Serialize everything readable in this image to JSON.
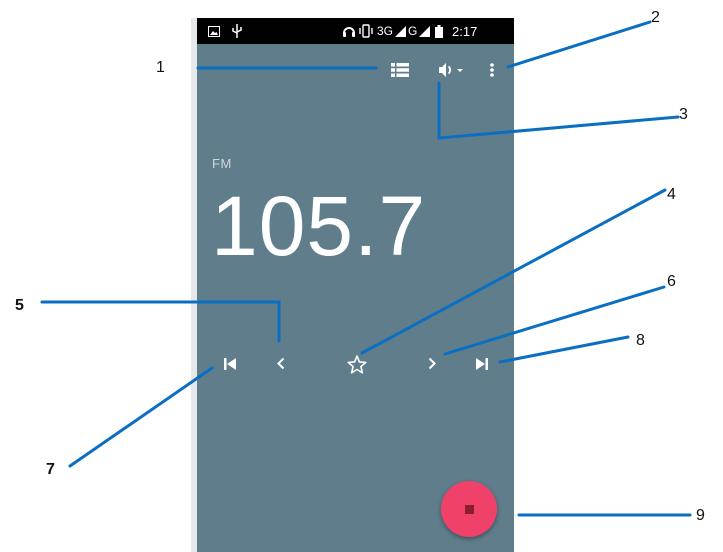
{
  "status_bar": {
    "network": "3G",
    "network_2": "G",
    "time": "2:17",
    "icons": [
      "image-icon",
      "usb-icon",
      "headset-icon",
      "vibrate-icon",
      "signal-icon",
      "signal-icon",
      "battery-icon"
    ]
  },
  "toolbar": {
    "icons": [
      "station-list-icon",
      "speaker-icon",
      "overflow-menu-icon"
    ]
  },
  "radio": {
    "band": "FM",
    "frequency": "105.7"
  },
  "controls": {
    "icons": [
      "skip-previous-icon",
      "chevron-left-icon",
      "star-outline-icon",
      "chevron-right-icon",
      "skip-next-icon"
    ]
  },
  "fab": {
    "icon": "stop-icon",
    "color": "#f0416b"
  },
  "callouts": [
    "1",
    "2",
    "3",
    "4",
    "5",
    "6",
    "7",
    "8",
    "9"
  ],
  "colors": {
    "screen_background": "#607d8b",
    "status_bar": "#000000",
    "annotation_line": "#0a6fc2",
    "fab": "#f0416b"
  }
}
